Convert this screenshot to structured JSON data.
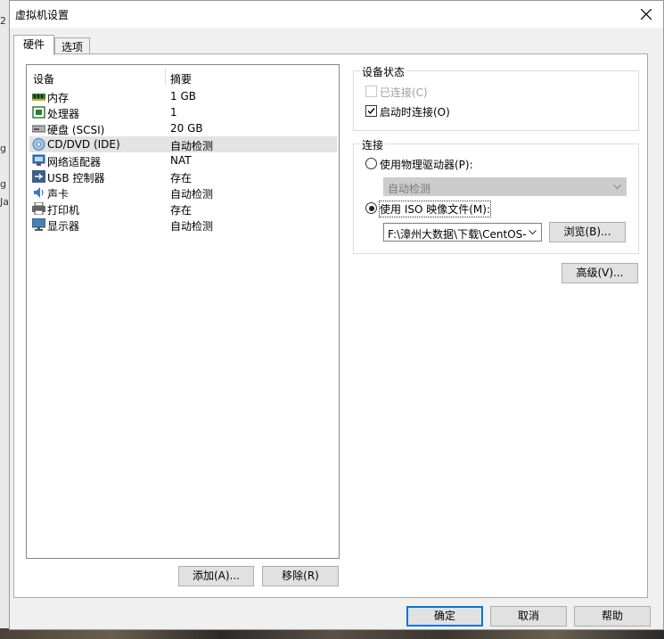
{
  "window": {
    "title": "虚拟机设置"
  },
  "tabs": [
    {
      "label": "硬件"
    },
    {
      "label": "选项"
    }
  ],
  "device_list": {
    "columns": {
      "device": "设备",
      "summary": "摘要"
    },
    "items": [
      {
        "name": "内存",
        "summary": "1 GB",
        "icon": "memory-icon"
      },
      {
        "name": "处理器",
        "summary": "1",
        "icon": "processor-icon"
      },
      {
        "name": "硬盘 (SCSI)",
        "summary": "20 GB",
        "icon": "hard-disk-icon"
      },
      {
        "name": "CD/DVD (IDE)",
        "summary": "自动检测",
        "icon": "cd-dvd-icon"
      },
      {
        "name": "网络适配器",
        "summary": "NAT",
        "icon": "network-adapter-icon"
      },
      {
        "name": "USB 控制器",
        "summary": "存在",
        "icon": "usb-icon"
      },
      {
        "name": "声卡",
        "summary": "自动检测",
        "icon": "sound-card-icon"
      },
      {
        "name": "打印机",
        "summary": "存在",
        "icon": "printer-icon"
      },
      {
        "name": "显示器",
        "summary": "自动检测",
        "icon": "display-icon"
      }
    ],
    "selected_index": 3
  },
  "buttons": {
    "add": "添加(A)...",
    "remove": "移除(R)",
    "ok": "确定",
    "cancel": "取消",
    "help": "帮助",
    "advanced": "高级(V)...",
    "browse": "浏览(B)..."
  },
  "device_status": {
    "title": "设备状态",
    "connected": {
      "label": "已连接(C)",
      "checked": false,
      "disabled": true
    },
    "connect_at_power_on": {
      "label": "启动时连接(O)",
      "checked": true
    }
  },
  "connection": {
    "title": "连接",
    "physical": {
      "label": "使用物理驱动器(P):",
      "selected": false
    },
    "physical_select": {
      "value": "自动检测",
      "disabled": true
    },
    "iso": {
      "label": "使用 ISO 映像文件(M):",
      "selected": true
    },
    "iso_path": "F:\\漳州大数据\\下载\\CentOS-"
  },
  "background_letters": [
    "2",
    "g",
    "g",
    "Ja",
    "g"
  ]
}
